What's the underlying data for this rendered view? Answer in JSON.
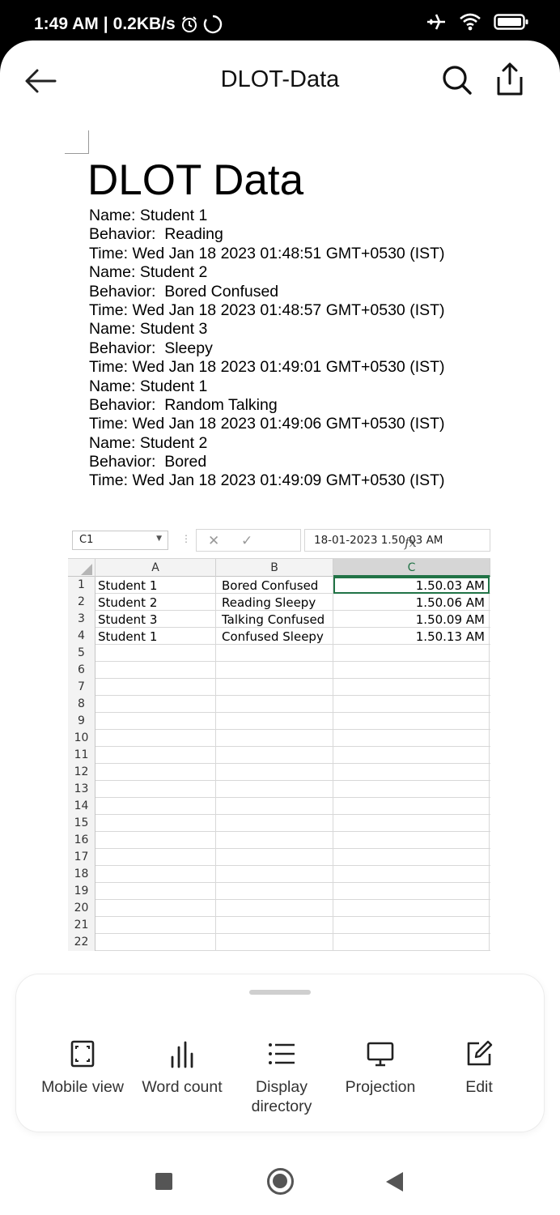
{
  "status_bar": {
    "time": "1:49 AM",
    "separator": "|",
    "speed": "0.2KB/s"
  },
  "app_bar": {
    "title": "DLOT-Data"
  },
  "document": {
    "title": "DLOT Data",
    "lines": [
      "Name: Student 1",
      "Behavior:  Reading",
      "Time: Wed Jan 18 2023 01:48:51 GMT+0530 (IST)",
      "Name: Student 2",
      "Behavior:  Bored Confused",
      "Time: Wed Jan 18 2023 01:48:57 GMT+0530 (IST)",
      "Name: Student 3",
      "Behavior:  Sleepy",
      "Time: Wed Jan 18 2023 01:49:01 GMT+0530 (IST)",
      "Name: Student 1",
      "Behavior:  Random Talking",
      "Time: Wed Jan 18 2023 01:49:06 GMT+0530 (IST)",
      "Name: Student 2",
      "Behavior:  Bored",
      "Time: Wed Jan 18 2023 01:49:09 GMT+0530 (IST)"
    ]
  },
  "spreadsheet": {
    "name_box": "C1",
    "fx_label": "fx",
    "formula_value": "18-01-2023  1.50.03 AM",
    "columns": [
      "A",
      "B",
      "C"
    ],
    "rows": [
      {
        "num": "1",
        "a": "Student 1",
        "b": "Bored Confused",
        "c": "1.50.03 AM"
      },
      {
        "num": "2",
        "a": "Student 2",
        "b": "Reading Sleepy",
        "c": "1.50.06 AM"
      },
      {
        "num": "3",
        "a": "Student 3",
        "b": "Talking  Confused",
        "c": "1.50.09 AM"
      },
      {
        "num": "4",
        "a": "Student 1",
        "b": "Confused  Sleepy",
        "c": "1.50.13 AM"
      },
      {
        "num": "5",
        "a": "",
        "b": "",
        "c": ""
      },
      {
        "num": "6",
        "a": "",
        "b": "",
        "c": ""
      },
      {
        "num": "7",
        "a": "",
        "b": "",
        "c": ""
      },
      {
        "num": "8",
        "a": "",
        "b": "",
        "c": ""
      },
      {
        "num": "9",
        "a": "",
        "b": "",
        "c": ""
      },
      {
        "num": "10",
        "a": "",
        "b": "",
        "c": ""
      },
      {
        "num": "11",
        "a": "",
        "b": "",
        "c": ""
      },
      {
        "num": "12",
        "a": "",
        "b": "",
        "c": ""
      },
      {
        "num": "13",
        "a": "",
        "b": "",
        "c": ""
      },
      {
        "num": "14",
        "a": "",
        "b": "",
        "c": ""
      },
      {
        "num": "15",
        "a": "",
        "b": "",
        "c": ""
      },
      {
        "num": "16",
        "a": "",
        "b": "",
        "c": ""
      },
      {
        "num": "17",
        "a": "",
        "b": "",
        "c": ""
      },
      {
        "num": "18",
        "a": "",
        "b": "",
        "c": ""
      },
      {
        "num": "19",
        "a": "",
        "b": "",
        "c": ""
      },
      {
        "num": "20",
        "a": "",
        "b": "",
        "c": ""
      },
      {
        "num": "21",
        "a": "",
        "b": "",
        "c": ""
      },
      {
        "num": "22",
        "a": "",
        "b": "",
        "c": ""
      }
    ]
  },
  "bottom_sheet": {
    "actions": [
      {
        "label": "Mobile view",
        "icon": "fullscreen-icon"
      },
      {
        "label": "Word count",
        "icon": "bar-chart-icon"
      },
      {
        "label": "Display directory",
        "icon": "list-icon"
      },
      {
        "label": "Projection",
        "icon": "monitor-icon"
      },
      {
        "label": "Edit",
        "icon": "edit-icon"
      }
    ]
  },
  "colors": {
    "excel_green": "#217346",
    "text": "#111111",
    "nav_gray": "#555555"
  }
}
